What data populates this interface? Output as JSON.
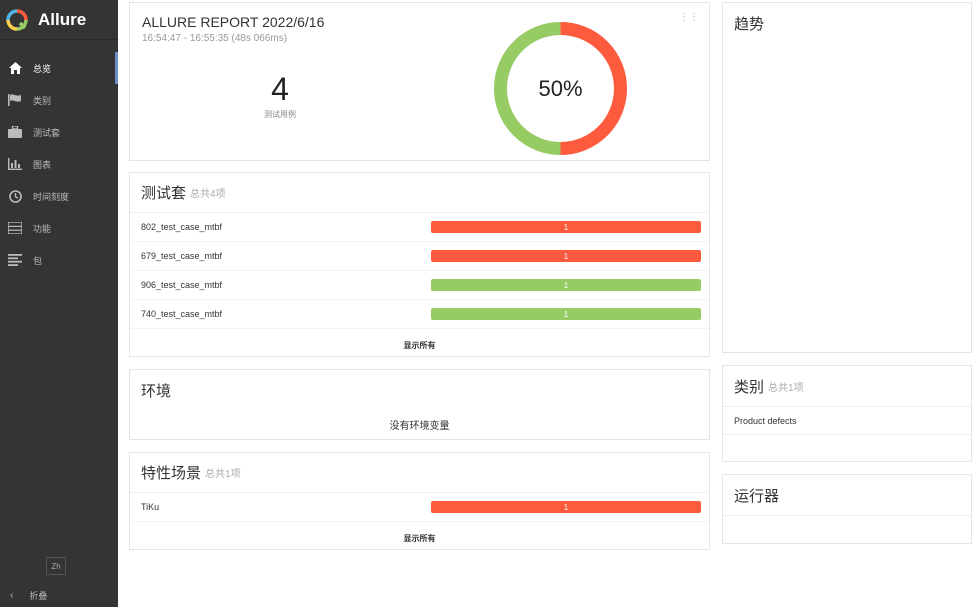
{
  "sidebar": {
    "brand": "Allure",
    "items": [
      {
        "label": "总览",
        "icon": "home-icon",
        "active": true
      },
      {
        "label": "类别",
        "icon": "flag-icon"
      },
      {
        "label": "测试套",
        "icon": "briefcase-icon"
      },
      {
        "label": "图表",
        "icon": "bar-chart-icon"
      },
      {
        "label": "时间刻度",
        "icon": "clock-icon"
      },
      {
        "label": "功能",
        "icon": "list-icon"
      },
      {
        "label": "包",
        "icon": "align-left-icon"
      }
    ],
    "language": "Zh",
    "collapse": "折叠"
  },
  "summary": {
    "title": "ALLURE REPORT 2022/6/16",
    "time_range": "16:54:47 - 16:55:35 (48s 066ms)",
    "count": "4",
    "count_label": "测试用例",
    "percent": "50%",
    "passed_fraction": 0.5,
    "drag_icon": "drag-handle-icon"
  },
  "suites": {
    "title": "测试套",
    "subtitle": "总共4项",
    "rows": [
      {
        "name": "802_test_case_mtbf",
        "count": "1",
        "status": "failed"
      },
      {
        "name": "679_test_case_mtbf",
        "count": "1",
        "status": "failed"
      },
      {
        "name": "906_test_case_mtbf",
        "count": "1",
        "status": "passed"
      },
      {
        "name": "740_test_case_mtbf",
        "count": "1",
        "status": "passed"
      }
    ],
    "show_all": "显示所有"
  },
  "environment": {
    "title": "环境",
    "empty": "没有环境变量"
  },
  "features": {
    "title": "特性场景",
    "subtitle": "总共1项",
    "rows": [
      {
        "name": "TiKu",
        "count": "1",
        "status": "failed"
      }
    ],
    "show_all": "显示所有"
  },
  "trend": {
    "title": "趋势"
  },
  "categories": {
    "title": "类别",
    "subtitle": "总共1项",
    "rows": [
      {
        "name": "Product defects"
      }
    ]
  },
  "executors": {
    "title": "运行器"
  },
  "colors": {
    "failed": "#fd5a3e",
    "passed": "#97cc64",
    "sidebar": "#343434"
  }
}
